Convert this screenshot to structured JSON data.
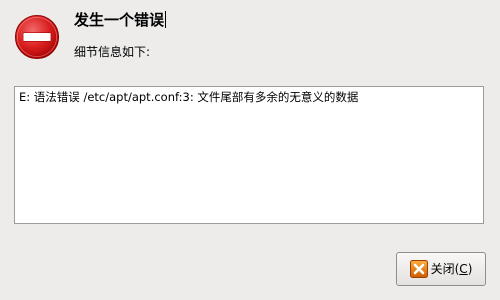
{
  "dialog": {
    "title": "发生一个错误",
    "subtitle": "细节信息如下:",
    "details": "E: 语法错误  /etc/apt/apt.conf:3: 文件尾部有多余的无意义的数据",
    "icons": {
      "error": "stop-error-icon",
      "close": "close-x-icon"
    },
    "colors": {
      "error_red": "#cc0000",
      "close_orange": "#f57900"
    }
  },
  "buttons": {
    "close": {
      "label_prefix": "关闭(",
      "mnemonic": "C",
      "label_suffix": ")"
    }
  }
}
